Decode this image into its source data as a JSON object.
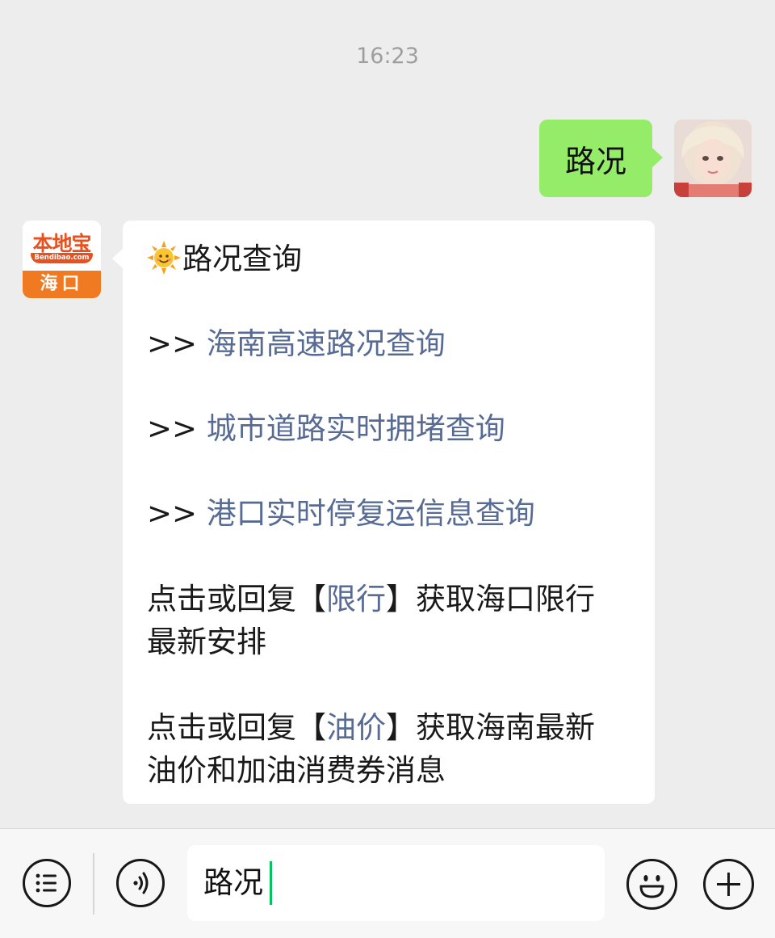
{
  "chat": {
    "timestamp": "16:23",
    "outgoing": {
      "text": "路况"
    },
    "incoming": {
      "avatar": {
        "brand": "本地宝",
        "url": "Bendibao.com",
        "city": "海口"
      },
      "title": "路况查询",
      "lines": [
        {
          "prefix": ">> ",
          "link": "海南高速路况查询"
        },
        {
          "prefix": ">> ",
          "link": "城市道路实时拥堵查询"
        },
        {
          "prefix": ">> ",
          "link": "港口实时停复运信息查询"
        }
      ],
      "xianxing": {
        "before": "点击或回复【",
        "link": "限行",
        "after": "】获取海口限行",
        "line2": "最新安排"
      },
      "youjia": {
        "before": "点击或回复【",
        "link": "油价",
        "after": "】获取海南最新",
        "line2": "油价和加油消费券消息"
      }
    }
  },
  "input_bar": {
    "value": "路况",
    "icons": [
      "menu-list-icon",
      "voice-icon",
      "emoji-icon",
      "plus-icon"
    ]
  },
  "colors": {
    "background": "#ededed",
    "outgoing_bubble": "#95ec69",
    "incoming_bubble": "#ffffff",
    "link": "#576b95",
    "cursor": "#07c160",
    "brand_orange": "#e8501e"
  }
}
